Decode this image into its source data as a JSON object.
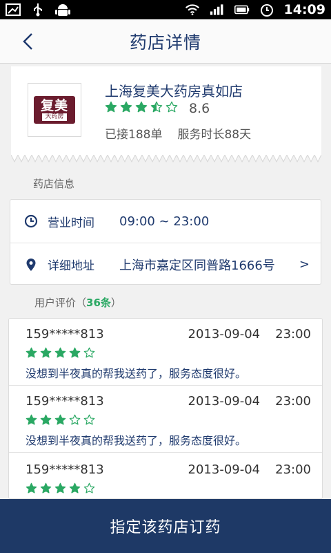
{
  "status_bar": {
    "time": "14:09"
  },
  "header": {
    "title": "药店详情"
  },
  "store": {
    "name": "上海复美大药房真如店",
    "logo_text": "复美",
    "logo_subtext": "大药房",
    "rating": 3.5,
    "score": "8.6",
    "orders": "已接188单",
    "service_time": "服务时长88天"
  },
  "info_section": {
    "label": "药店信息",
    "hours_label": "营业时间",
    "hours_value": "09:00 ~ 23:00",
    "address_label": "详细地址",
    "address_value": "上海市嘉定区同普路1666号",
    "arrow": ">"
  },
  "reviews_section": {
    "label_prefix": "用户评价（",
    "count": "36条",
    "label_suffix": "）",
    "items": [
      {
        "user": "159*****813",
        "date": "2013-09-04",
        "time": "23:00",
        "stars": 4,
        "text": "没想到半夜真的帮我送药了，服务态度很好。"
      },
      {
        "user": "159*****813",
        "date": "2013-09-04",
        "time": "23:00",
        "stars": 3,
        "text": "没想到半夜真的帮我送药了，服务态度很好。"
      },
      {
        "user": "159*****813",
        "date": "2013-09-04",
        "time": "23:00",
        "stars": 4,
        "text": ""
      }
    ]
  },
  "order_button": {
    "label": "指定该药店订药"
  },
  "colors": {
    "navy": "#1e3966",
    "star_green": "#2aa863",
    "accent_text": "#1f3a6e"
  }
}
